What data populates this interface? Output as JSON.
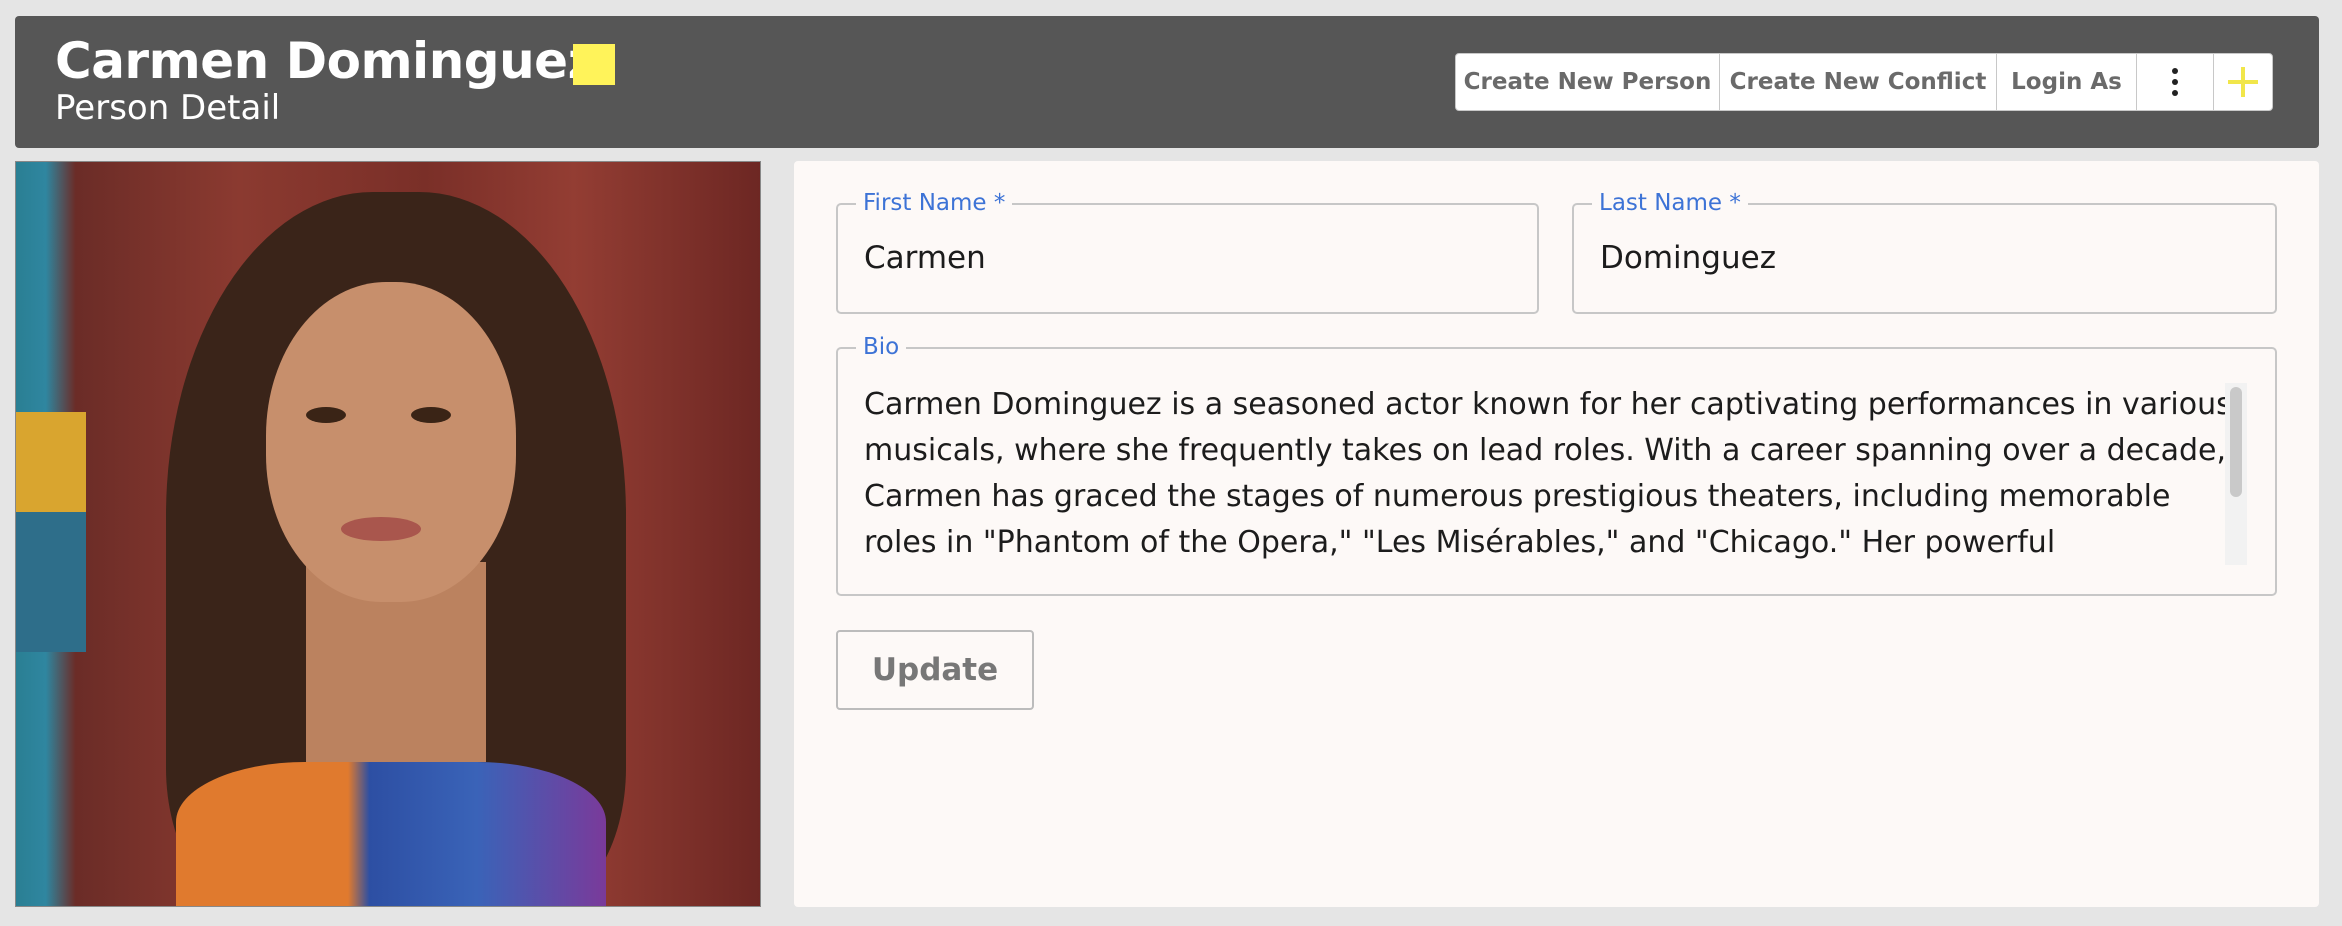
{
  "header": {
    "title": "Carmen Dominguez",
    "subtitle": "Person Detail",
    "badge_color": "#fff35a",
    "actions": {
      "create_person": "Create New Person",
      "create_conflict": "Create New Conflict",
      "login_as": "Login As",
      "more_icon": "more-vertical-icon",
      "add_icon": "plus-icon"
    }
  },
  "form": {
    "first_name": {
      "label": "First Name *",
      "value": "Carmen"
    },
    "last_name": {
      "label": "Last Name *",
      "value": "Dominguez"
    },
    "bio": {
      "label": "Bio",
      "value": "Carmen Dominguez is a seasoned actor known for her captivating performances in various musicals, where she frequently takes on lead roles. With a career spanning over a decade, Carmen has graced the stages of numerous prestigious theaters, including memorable roles in \"Phantom of the Opera,\" \"Les Misérables,\" and \"Chicago.\" Her powerful"
    },
    "update_label": "Update"
  },
  "colors": {
    "header_bg": "#565656",
    "label_accent": "#3d73d6",
    "plus_accent": "#f1e64a"
  }
}
